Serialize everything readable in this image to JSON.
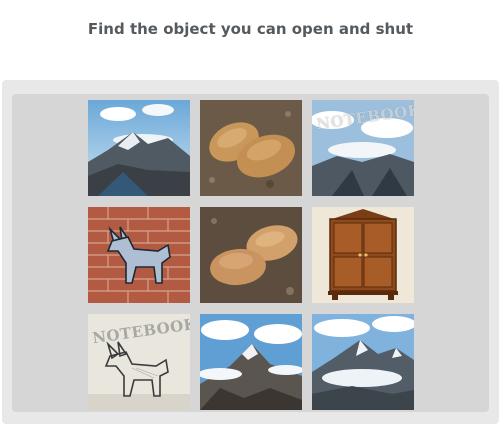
{
  "prompt": {
    "text": "Find the object you can open and shut"
  },
  "tiles": [
    {
      "subject": "mountains",
      "watermark": ""
    },
    {
      "subject": "potatoes",
      "watermark": ""
    },
    {
      "subject": "mountains",
      "watermark": "NOTEBOOK"
    },
    {
      "subject": "dog-on-brick-wall",
      "watermark": ""
    },
    {
      "subject": "potatoes",
      "watermark": ""
    },
    {
      "subject": "wooden-cabinet",
      "watermark": ""
    },
    {
      "subject": "dog-sketch",
      "watermark": "NOTEBOOK"
    },
    {
      "subject": "mountains",
      "watermark": ""
    },
    {
      "subject": "mountains",
      "watermark": ""
    }
  ],
  "colors": {
    "prompt_text": "#555a5e",
    "panel_outer": "#e8e8e8",
    "panel_inner": "#d6d6d6"
  }
}
